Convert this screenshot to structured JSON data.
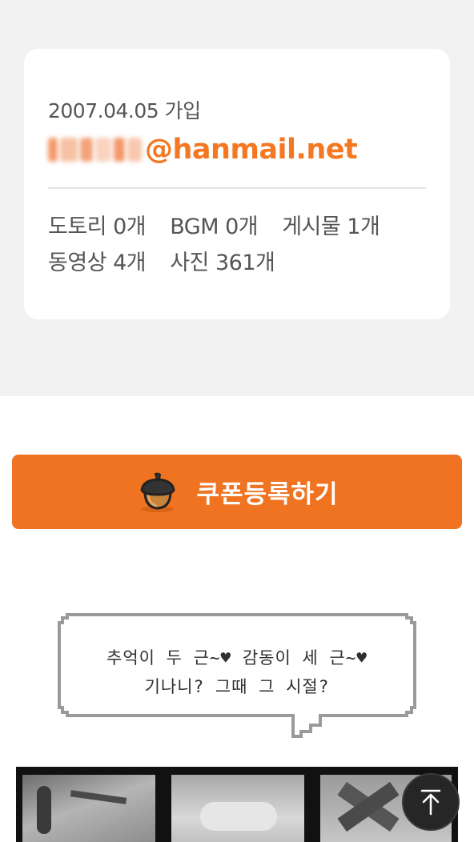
{
  "profile": {
    "join_date": "2007.04.05 가입",
    "email_domain": "@hanmail.net",
    "stats_row_1": [
      {
        "label": "도토리 0개"
      },
      {
        "label": "BGM 0개"
      },
      {
        "label": "게시물 1개"
      }
    ],
    "stats_row_2": [
      {
        "label": "동영상 4개"
      },
      {
        "label": "사진 361개"
      }
    ]
  },
  "coupon": {
    "label": "쿠폰등록하기",
    "icon": "acorn-icon"
  },
  "banner": {
    "line1": "추억이 두 근~♥  감동이 세 근~♥",
    "line2": "기나니? 그때 그 시절?"
  },
  "scroll_top": {
    "icon": "arrow-up-icon"
  },
  "colors": {
    "accent": "#f07322",
    "email_orange": "#f47721",
    "card_bg": "#ffffff",
    "section_bg": "#f2f2f2",
    "text_gray": "#555555"
  }
}
